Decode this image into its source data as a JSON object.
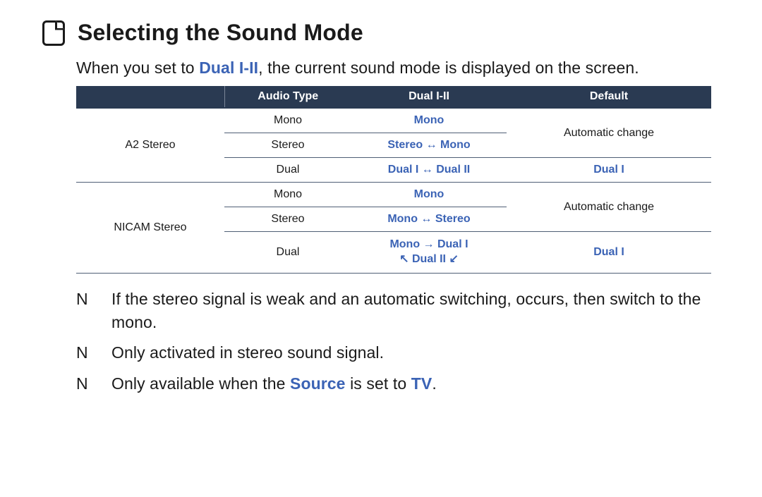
{
  "title": "Selecting the Sound Mode",
  "intro": {
    "pre": "When you set to ",
    "dual": "Dual I-II",
    "post": ", the current sound mode is displayed on the screen."
  },
  "table": {
    "headers": {
      "category": "",
      "audio_type": "Audio Type",
      "dual": "Dual I-II",
      "default": "Default"
    },
    "groups": [
      {
        "name": "A2 Stereo",
        "rows": [
          {
            "audio": "Mono",
            "dual": "Mono",
            "default": "Automatic change",
            "default_span": 2
          },
          {
            "audio": "Stereo",
            "dual": "Stereo ↔ Mono"
          },
          {
            "audio": "Dual",
            "dual": "Dual I ↔ Dual II",
            "default": "Dual I",
            "default_accent": true
          }
        ]
      },
      {
        "name": "NICAM Stereo",
        "rows": [
          {
            "audio": "Mono",
            "dual": "Mono",
            "default": "Automatic change",
            "default_span": 2
          },
          {
            "audio": "Stereo",
            "dual": "Mono ↔ Stereo"
          },
          {
            "audio": "Dual",
            "dual_lines": [
              "Mono → Dual I",
              "↖ Dual II ↙"
            ],
            "default": "Dual I",
            "default_accent": true
          }
        ]
      }
    ]
  },
  "notes": [
    {
      "bullet": "N",
      "parts": [
        {
          "text": "If the stereo signal is weak and an automatic switching, occurs, then switch to the mono."
        }
      ]
    },
    {
      "bullet": "N",
      "parts": [
        {
          "text": "Only activated in stereo sound signal."
        }
      ]
    },
    {
      "bullet": "N",
      "parts": [
        {
          "text": "Only available when the "
        },
        {
          "text": "Source",
          "accent": true
        },
        {
          "text": " is set to "
        },
        {
          "text": "TV",
          "accent": true
        },
        {
          "text": "."
        }
      ]
    }
  ]
}
